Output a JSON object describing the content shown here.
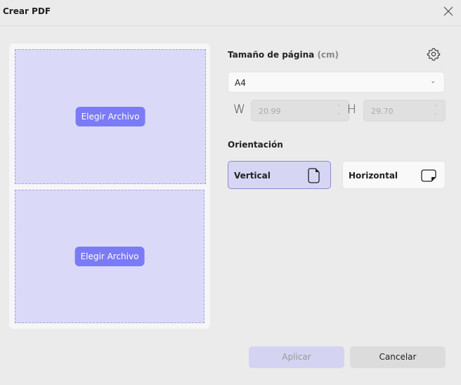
{
  "dialog": {
    "title": "Crear PDF"
  },
  "upload": {
    "choose_label_1": "Elegir Archivo",
    "choose_label_2": "Elegir Archivo"
  },
  "page_size": {
    "label": "Tamaño de página",
    "unit": "(cm)",
    "selected": "A4",
    "width_label": "W",
    "width_value": "20.99",
    "height_label": "H",
    "height_value": "29.70"
  },
  "orientation": {
    "label": "Orientación",
    "options": [
      {
        "label": "Vertical",
        "selected": true
      },
      {
        "label": "Horizontal",
        "selected": false
      }
    ]
  },
  "footer": {
    "apply": "Aplicar",
    "cancel": "Cancelar"
  }
}
